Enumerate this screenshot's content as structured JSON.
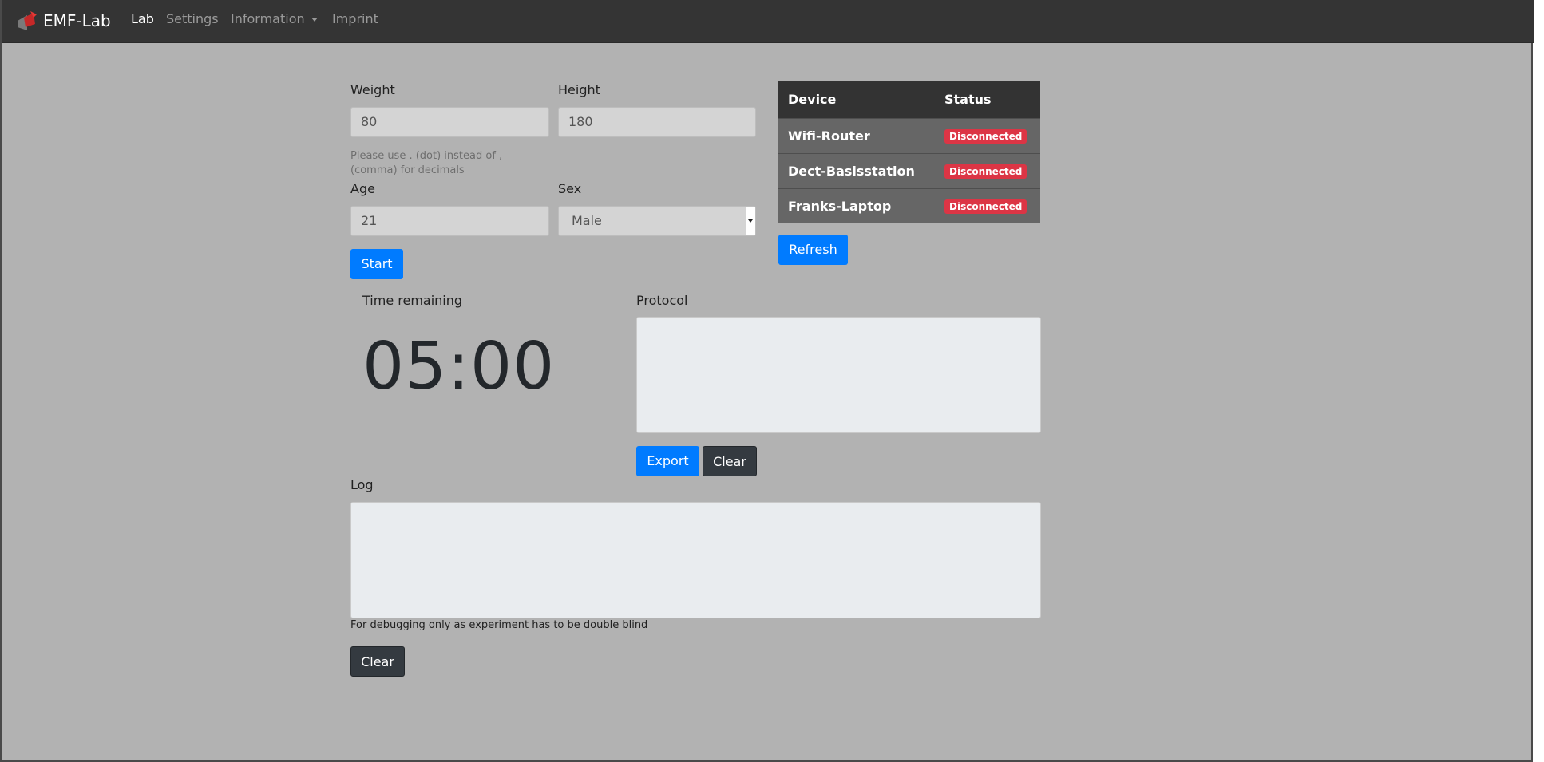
{
  "navbar": {
    "brand": "EMF-Lab",
    "items": [
      {
        "label": "Lab",
        "active": true
      },
      {
        "label": "Settings",
        "active": false
      },
      {
        "label": "Information",
        "active": false
      },
      {
        "label": "Imprint",
        "active": false
      }
    ]
  },
  "form": {
    "weight_label": "Weight",
    "weight_value": "80",
    "height_label": "Height",
    "height_value": "180",
    "hint": "Please use . (dot) instead of , (comma) for decimals",
    "age_label": "Age",
    "age_value": "21",
    "sex_label": "Sex",
    "sex_value": "Male",
    "start_label": "Start"
  },
  "devices": {
    "headers": [
      "Device",
      "Status"
    ],
    "rows": [
      {
        "device": "Wifi-Router",
        "status": "Disconnected"
      },
      {
        "device": "Dect-Basisstation",
        "status": "Disconnected"
      },
      {
        "device": "Franks-Laptop",
        "status": "Disconnected"
      }
    ],
    "refresh_label": "Refresh"
  },
  "timer": {
    "label": "Time remaining",
    "value": "05:00"
  },
  "protocol": {
    "label": "Protocol",
    "export_label": "Export",
    "clear_label": "Clear"
  },
  "log": {
    "label": "Log",
    "note": "For debugging only as experiment has to be double blind",
    "clear_label": "Clear"
  },
  "colors": {
    "navbar_bg": "#343434",
    "page_bg": "#b2b2b2",
    "primary": "#007bff",
    "dark": "#343a40",
    "danger": "#dc3545"
  }
}
